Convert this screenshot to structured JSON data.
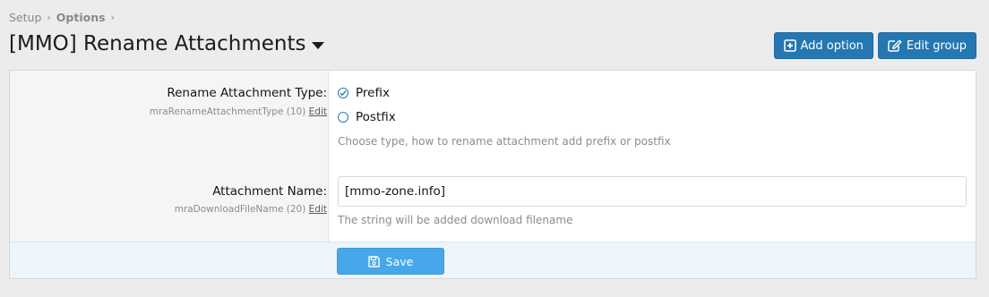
{
  "breadcrumb": {
    "items": [
      "Setup",
      "Options"
    ]
  },
  "header": {
    "title": "[MMO] Rename Attachments"
  },
  "toolbar": {
    "add_option": "Add option",
    "edit_group": "Edit group"
  },
  "options": [
    {
      "label": "Rename Attachment Type:",
      "meta": "mraRenameAttachmentType (10)",
      "edit": "Edit",
      "choices": [
        {
          "label": "Prefix",
          "selected": true
        },
        {
          "label": "Postfix",
          "selected": false
        }
      ],
      "hint": "Choose type, how to rename attachment add prefix or postfix"
    },
    {
      "label": "Attachment Name:",
      "meta": "mraDownloadFileName (20)",
      "edit": "Edit",
      "value": "[mmo-zone.info]",
      "hint": "The string will be added download filename"
    }
  ],
  "footer": {
    "save_label": "Save"
  },
  "colors": {
    "primary": "#2577b1",
    "save": "#47a7eb",
    "footer_bg": "#edf4fb"
  },
  "icons": {
    "add": "plus-square-icon",
    "edit": "edit-icon",
    "save": "floppy-disk-icon",
    "dropdown": "caret-down-icon"
  }
}
